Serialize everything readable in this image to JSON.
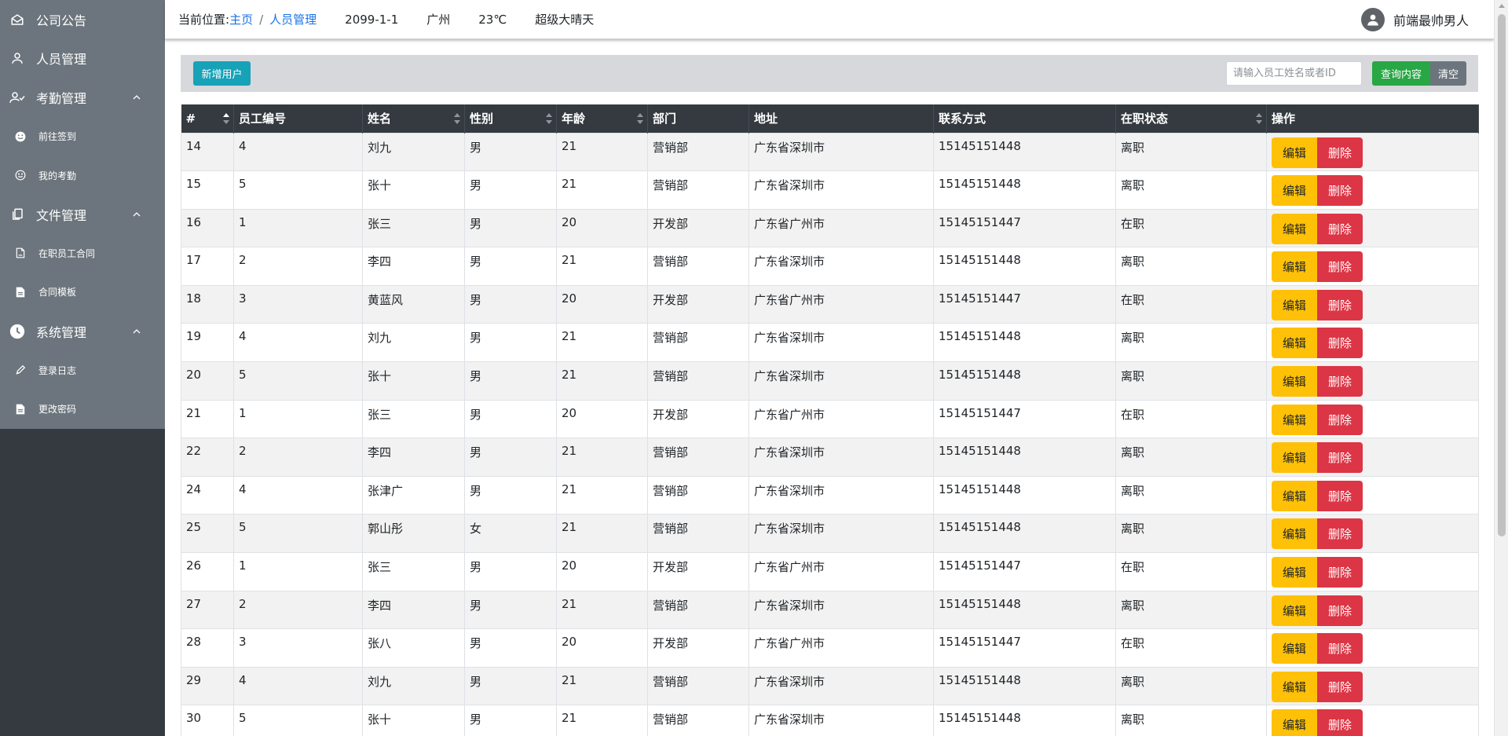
{
  "sidebar": {
    "items": [
      {
        "label": "公司公告",
        "icon": "envelope-open-icon",
        "type": "top"
      },
      {
        "label": "人员管理",
        "icon": "user-icon",
        "type": "top"
      },
      {
        "label": "考勤管理",
        "icon": "user-check-icon",
        "type": "top",
        "expanded": true
      },
      {
        "label": "前往签到",
        "icon": "smile-filled-icon",
        "type": "sub"
      },
      {
        "label": "我的考勤",
        "icon": "smile-icon",
        "type": "sub"
      },
      {
        "label": "文件管理",
        "icon": "copy-icon",
        "type": "top",
        "expanded": true
      },
      {
        "label": "在职员工合同",
        "icon": "file-icon",
        "type": "sub"
      },
      {
        "label": "合同模板",
        "icon": "file-text-icon",
        "type": "sub"
      },
      {
        "label": "系统管理",
        "icon": "clock-icon",
        "type": "top",
        "expanded": true
      },
      {
        "label": "登录日志",
        "icon": "pen-icon",
        "type": "sub"
      },
      {
        "label": "更改密码",
        "icon": "file-text-icon",
        "type": "sub"
      }
    ]
  },
  "header": {
    "location_label": "当前位置:",
    "breadcrumb_home": "主页",
    "breadcrumb_sep": "/",
    "breadcrumb_current": "人员管理",
    "date": "2099-1-1",
    "city": "广州",
    "temperature": "23℃",
    "weather": "超级大晴天",
    "username": "前端最帅男人"
  },
  "toolbar": {
    "add_label": "新增用户",
    "search_placeholder": "请输入员工姓名或者ID",
    "search_value": "",
    "query_label": "查询内容",
    "clear_label": "清空"
  },
  "table": {
    "columns": [
      "#",
      "员工编号",
      "姓名",
      "性别",
      "年龄",
      "部门",
      "地址",
      "联系方式",
      "在职状态",
      "操作"
    ],
    "edit_label": "编辑",
    "delete_label": "删除",
    "rows": [
      [
        "14",
        "4",
        "刘九",
        "男",
        "21",
        "营销部",
        "广东省深圳市",
        "15145151448",
        "离职"
      ],
      [
        "15",
        "5",
        "张十",
        "男",
        "21",
        "营销部",
        "广东省深圳市",
        "15145151448",
        "离职"
      ],
      [
        "16",
        "1",
        "张三",
        "男",
        "20",
        "开发部",
        "广东省广州市",
        "15145151447",
        "在职"
      ],
      [
        "17",
        "2",
        "李四",
        "男",
        "21",
        "营销部",
        "广东省深圳市",
        "15145151448",
        "离职"
      ],
      [
        "18",
        "3",
        "黄蓝风",
        "男",
        "20",
        "开发部",
        "广东省广州市",
        "15145151447",
        "在职"
      ],
      [
        "19",
        "4",
        "刘九",
        "男",
        "21",
        "营销部",
        "广东省深圳市",
        "15145151448",
        "离职"
      ],
      [
        "20",
        "5",
        "张十",
        "男",
        "21",
        "营销部",
        "广东省深圳市",
        "15145151448",
        "离职"
      ],
      [
        "21",
        "1",
        "张三",
        "男",
        "20",
        "开发部",
        "广东省广州市",
        "15145151447",
        "在职"
      ],
      [
        "22",
        "2",
        "李四",
        "男",
        "21",
        "营销部",
        "广东省深圳市",
        "15145151448",
        "离职"
      ],
      [
        "24",
        "4",
        "张津广",
        "男",
        "21",
        "营销部",
        "广东省深圳市",
        "15145151448",
        "离职"
      ],
      [
        "25",
        "5",
        "郭山彤",
        "女",
        "21",
        "营销部",
        "广东省深圳市",
        "15145151448",
        "离职"
      ],
      [
        "26",
        "1",
        "张三",
        "男",
        "20",
        "开发部",
        "广东省广州市",
        "15145151447",
        "在职"
      ],
      [
        "27",
        "2",
        "李四",
        "男",
        "21",
        "营销部",
        "广东省深圳市",
        "15145151448",
        "离职"
      ],
      [
        "28",
        "3",
        "张八",
        "男",
        "20",
        "开发部",
        "广东省广州市",
        "15145151447",
        "在职"
      ],
      [
        "29",
        "4",
        "刘九",
        "男",
        "21",
        "营销部",
        "广东省深圳市",
        "15145151448",
        "离职"
      ],
      [
        "30",
        "5",
        "张十",
        "男",
        "21",
        "营销部",
        "广东省深圳市",
        "15145151448",
        "离职"
      ]
    ]
  },
  "colors": {
    "sidebar_dark": "#343a40",
    "sidebar_menu": "#6c757d",
    "add_button": "#17a2b8",
    "query_button": "#28a745",
    "clear_button": "#6c757d",
    "edit_button": "#ffc107",
    "delete_button": "#dc3545",
    "link": "#1a73e8"
  }
}
